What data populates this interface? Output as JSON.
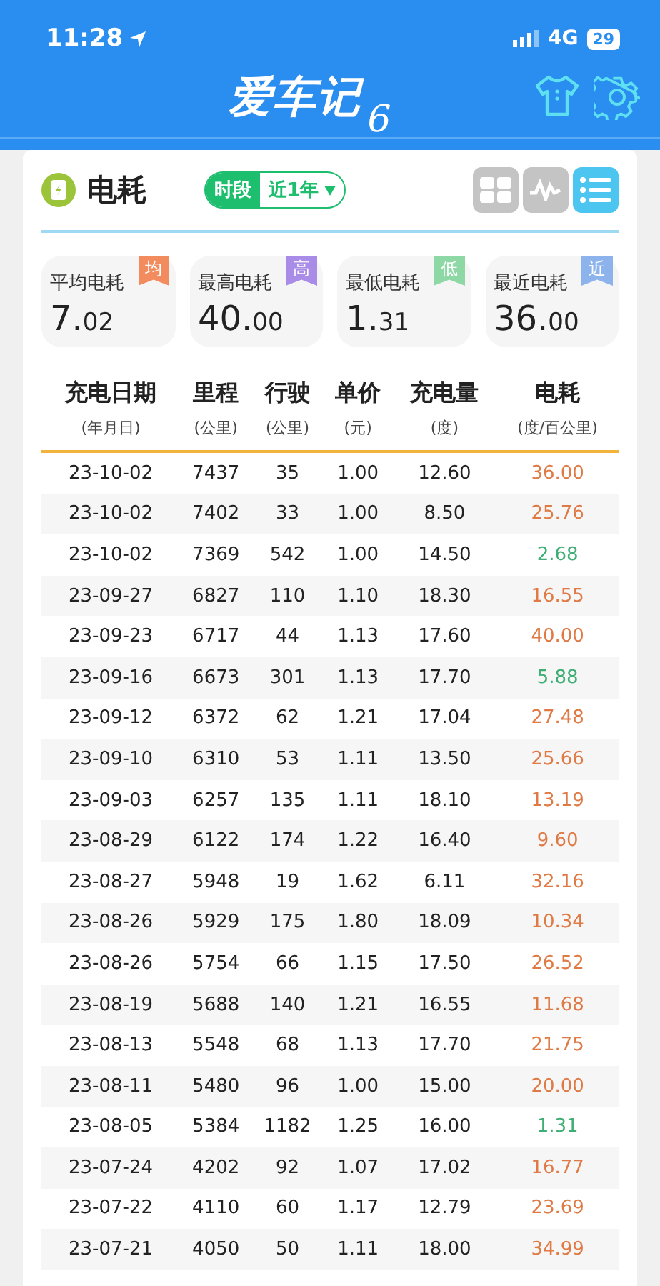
{
  "status_bar": {
    "time": "11:28",
    "network": "4G",
    "battery": "29"
  },
  "header": {
    "title": "爱车记",
    "version": "6"
  },
  "section": {
    "title": "电耗",
    "period_label": "时段",
    "period_value": "近1年",
    "views": [
      {
        "kind": "grid",
        "selected": false
      },
      {
        "kind": "wave",
        "selected": false
      },
      {
        "kind": "list",
        "selected": true
      }
    ]
  },
  "stats": [
    {
      "label": "平均电耗",
      "value": "7.02",
      "badge": "均",
      "color": "#f28c5e"
    },
    {
      "label": "最高电耗",
      "value": "40.00",
      "badge": "高",
      "color": "#a98ce8"
    },
    {
      "label": "最低电耗",
      "value": "1.31",
      "badge": "低",
      "color": "#8ed8a6"
    },
    {
      "label": "最近电耗",
      "value": "36.00",
      "badge": "近",
      "color": "#8db3ec"
    }
  ],
  "table": {
    "columns": [
      {
        "title": "充电日期",
        "unit": "(年月日)"
      },
      {
        "title": "里程",
        "unit": "(公里)"
      },
      {
        "title": "行驶",
        "unit": "(公里)"
      },
      {
        "title": "单价",
        "unit": "(元)"
      },
      {
        "title": "充电量",
        "unit": "(度)"
      },
      {
        "title": "电耗",
        "unit": "(度/百公里)"
      }
    ],
    "rows": [
      {
        "cells": [
          "23-10-02",
          "7437",
          "35",
          "1.00",
          "12.60",
          "36.00"
        ],
        "color": "#e07a45"
      },
      {
        "cells": [
          "23-10-02",
          "7402",
          "33",
          "1.00",
          "8.50",
          "25.76"
        ],
        "color": "#e07a45"
      },
      {
        "cells": [
          "23-10-02",
          "7369",
          "542",
          "1.00",
          "14.50",
          "2.68"
        ],
        "color": "#3fae74"
      },
      {
        "cells": [
          "23-09-27",
          "6827",
          "110",
          "1.10",
          "18.30",
          "16.55"
        ],
        "color": "#e07a45"
      },
      {
        "cells": [
          "23-09-23",
          "6717",
          "44",
          "1.13",
          "17.60",
          "40.00"
        ],
        "color": "#e07a45"
      },
      {
        "cells": [
          "23-09-16",
          "6673",
          "301",
          "1.13",
          "17.70",
          "5.88"
        ],
        "color": "#3fae74"
      },
      {
        "cells": [
          "23-09-12",
          "6372",
          "62",
          "1.21",
          "17.04",
          "27.48"
        ],
        "color": "#e07a45"
      },
      {
        "cells": [
          "23-09-10",
          "6310",
          "53",
          "1.11",
          "13.50",
          "25.66"
        ],
        "color": "#e07a45"
      },
      {
        "cells": [
          "23-09-03",
          "6257",
          "135",
          "1.11",
          "18.10",
          "13.19"
        ],
        "color": "#e07a45"
      },
      {
        "cells": [
          "23-08-29",
          "6122",
          "174",
          "1.22",
          "16.40",
          "9.60"
        ],
        "color": "#e07a45"
      },
      {
        "cells": [
          "23-08-27",
          "5948",
          "19",
          "1.62",
          "6.11",
          "32.16"
        ],
        "color": "#e07a45"
      },
      {
        "cells": [
          "23-08-26",
          "5929",
          "175",
          "1.80",
          "18.09",
          "10.34"
        ],
        "color": "#e07a45"
      },
      {
        "cells": [
          "23-08-26",
          "5754",
          "66",
          "1.15",
          "17.50",
          "26.52"
        ],
        "color": "#e07a45"
      },
      {
        "cells": [
          "23-08-19",
          "5688",
          "140",
          "1.21",
          "16.55",
          "11.68"
        ],
        "color": "#e07a45"
      },
      {
        "cells": [
          "23-08-13",
          "5548",
          "68",
          "1.13",
          "17.70",
          "21.75"
        ],
        "color": "#e07a45"
      },
      {
        "cells": [
          "23-08-11",
          "5480",
          "96",
          "1.00",
          "15.00",
          "20.00"
        ],
        "color": "#e07a45"
      },
      {
        "cells": [
          "23-08-05",
          "5384",
          "1182",
          "1.25",
          "16.00",
          "1.31"
        ],
        "color": "#3fae74"
      },
      {
        "cells": [
          "23-07-24",
          "4202",
          "92",
          "1.07",
          "17.02",
          "16.77"
        ],
        "color": "#e07a45"
      },
      {
        "cells": [
          "23-07-22",
          "4110",
          "60",
          "1.17",
          "12.79",
          "23.69"
        ],
        "color": "#e07a45"
      },
      {
        "cells": [
          "23-07-21",
          "4050",
          "50",
          "1.11",
          "18.00",
          "34.99"
        ],
        "color": "#e07a45"
      }
    ]
  }
}
